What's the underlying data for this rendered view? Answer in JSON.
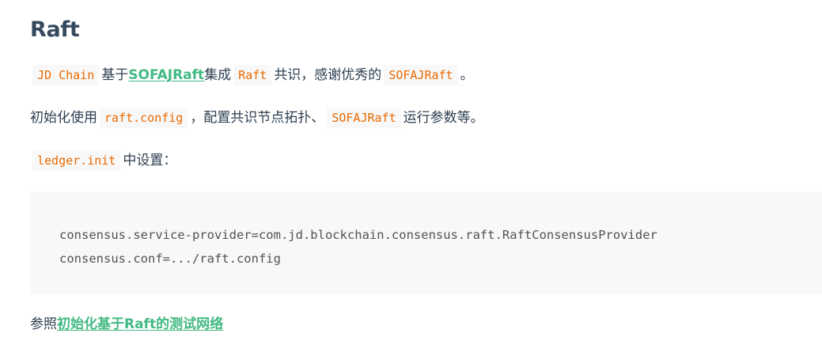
{
  "heading": "Raft",
  "p1": {
    "code1": "JD Chain",
    "text1": "基于",
    "link": "SOFAJRaft",
    "text2": "集成",
    "code2": "Raft",
    "text3": "共识，感谢优秀的",
    "code3": "SOFAJRaft",
    "text4": "。"
  },
  "p2": {
    "text1": "初始化使用",
    "code1": "raft.config",
    "text2": "，配置共识节点拓扑、",
    "code2": "SOFAJRaft",
    "text3": "运行参数等。"
  },
  "p3": {
    "code1": "ledger.init",
    "text1": "中设置："
  },
  "codeblock": {
    "lines": [
      "consensus.service-provider=com.jd.blockchain.consensus.raft.RaftConsensusProvider",
      "consensus.conf=.../raft.config"
    ]
  },
  "p4": {
    "text1": "参照",
    "link": "初始化基于Raft的测试网络"
  },
  "colors": {
    "link": "#42b983",
    "inline_code": "#e96900",
    "code_bg": "#f8f8f8",
    "heading": "#34495e"
  }
}
